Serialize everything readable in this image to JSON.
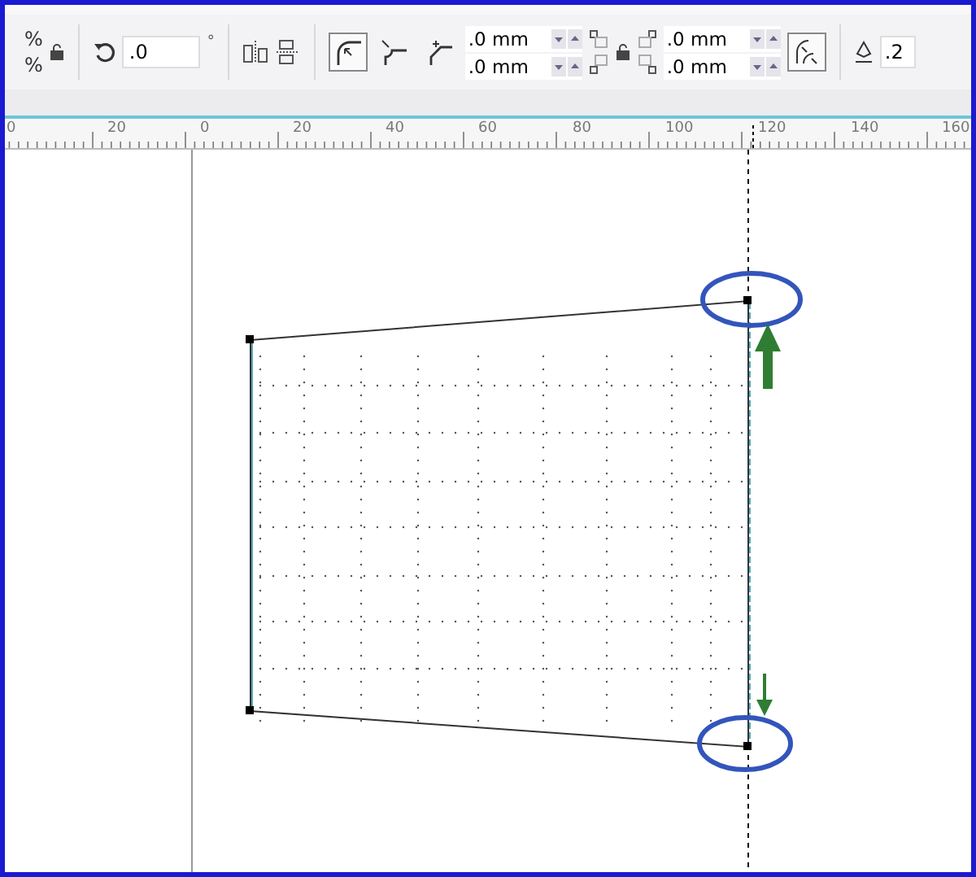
{
  "toolbar": {
    "scale_units": [
      "%",
      "%"
    ],
    "angle_field": {
      "value": ".0",
      "unit": "°"
    },
    "corner_tools": [
      {
        "kind": "round",
        "selected": true
      },
      {
        "kind": "scallop",
        "selected": false
      },
      {
        "kind": "chamfer",
        "selected": false
      }
    ],
    "corner_fields_left": [
      ".0 mm",
      ".0 mm"
    ],
    "corner_fields_right": [
      ".0 mm",
      ".0 mm"
    ],
    "outline_field": ".2"
  },
  "ruler": {
    "labels": [
      "0",
      "20",
      "0",
      "20",
      "40",
      "60",
      "80",
      "100",
      "120",
      "140",
      "160"
    ]
  }
}
